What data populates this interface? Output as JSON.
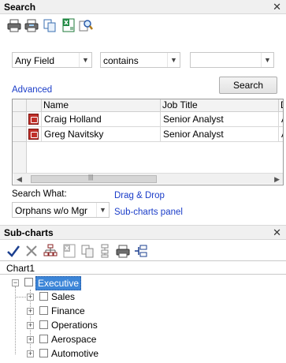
{
  "search_panel": {
    "title": "Search",
    "close_symbol": "✕",
    "toolbar": [
      "print-icon",
      "print-preview-icon",
      "copy-icon",
      "export-excel-icon",
      "find-icon"
    ],
    "field_select": {
      "value": "Any Field"
    },
    "operator_select": {
      "value": "contains"
    },
    "value_select": {
      "value": ""
    },
    "advanced_link": "Advanced",
    "search_button": "Search",
    "grid": {
      "columns": [
        "Name",
        "Job Title",
        "D"
      ],
      "rows": [
        {
          "name": "Craig Holland",
          "job_title": "Senior Analyst",
          "d": "A"
        },
        {
          "name": "Greg Navitsky",
          "job_title": "Senior Analyst",
          "d": "A"
        }
      ],
      "scroll_thumb_glyph": "|||"
    },
    "search_what_label": "Search What:",
    "search_what_select": {
      "value": "Orphans w/o Mgr"
    },
    "drag_drop_link": "Drag & Drop",
    "subcharts_link": "Sub-charts panel"
  },
  "subcharts_panel": {
    "title": "Sub-charts",
    "close_symbol": "✕",
    "toolbar": [
      "checkmark-icon",
      "delete-icon",
      "org-chart-icon",
      "export-excel-icon",
      "copy-icon",
      "hierarchy-icon",
      "print-icon",
      "split-icon"
    ],
    "chart_header": "Chart1",
    "tree": {
      "root": "Executive",
      "children": [
        "Sales",
        "Finance",
        "Operations",
        "Aerospace",
        "Automotive"
      ]
    }
  }
}
